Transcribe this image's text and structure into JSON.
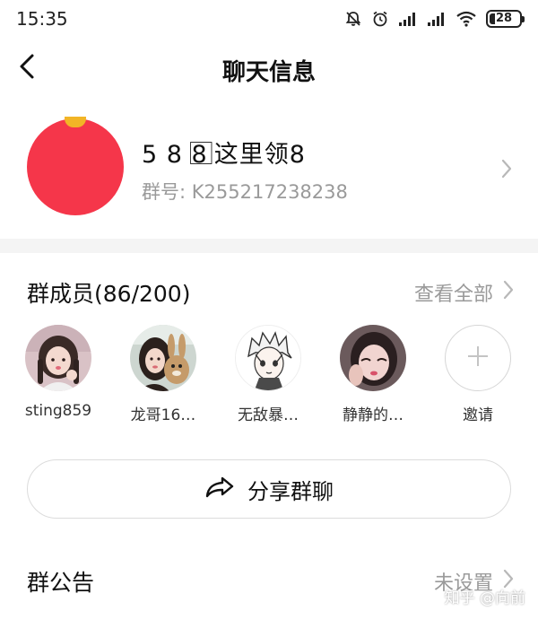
{
  "status_bar": {
    "time": "15:35",
    "battery": "28",
    "battery_level": 0.28,
    "icons": [
      "mute-bell-icon",
      "alarm-icon",
      "signal-icon",
      "signal-icon",
      "wifi-icon",
      "battery-icon"
    ]
  },
  "nav": {
    "title": "聊天信息",
    "back_icon": "chevron-left-icon"
  },
  "group": {
    "name": "5 8 8 ⃞这里领8",
    "id_label": "群号: ",
    "id_value": "K255217238238",
    "avatar_color": "#f5364a",
    "avatar_accent": "#f2b526"
  },
  "members": {
    "title": "群成员(86/200)",
    "view_all": "查看全部",
    "items": [
      {
        "name": "sting859",
        "avatar": "avatar-girl-icon"
      },
      {
        "name": "龙哥16…",
        "avatar": "avatar-woman-rabbit-icon"
      },
      {
        "name": "无敌暴…",
        "avatar": "avatar-anime-boy-icon"
      },
      {
        "name": "静静的…",
        "avatar": "avatar-woman-selfie-icon"
      }
    ],
    "invite_label": "邀请",
    "invite_icon": "plus-icon"
  },
  "share": {
    "label": "分享群聊",
    "icon": "share-arrow-icon"
  },
  "announcement": {
    "title": "群公告",
    "value": "未设置"
  },
  "watermark": "知乎 @向前"
}
